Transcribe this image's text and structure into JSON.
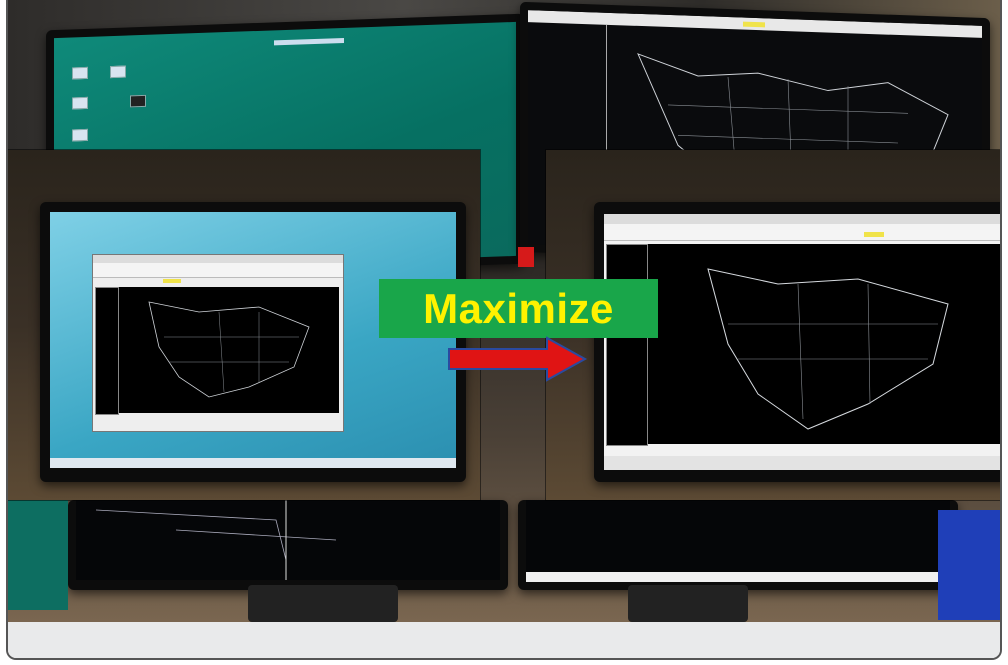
{
  "overlay": {
    "action_label": "Maximize",
    "colors": {
      "badge_bg": "#19a64a",
      "badge_text": "#fff200",
      "arrow": "#e01414",
      "arrow_outline": "#2a4aa0"
    }
  },
  "scene": {
    "description_icons": [
      "arrow-right-icon"
    ]
  }
}
